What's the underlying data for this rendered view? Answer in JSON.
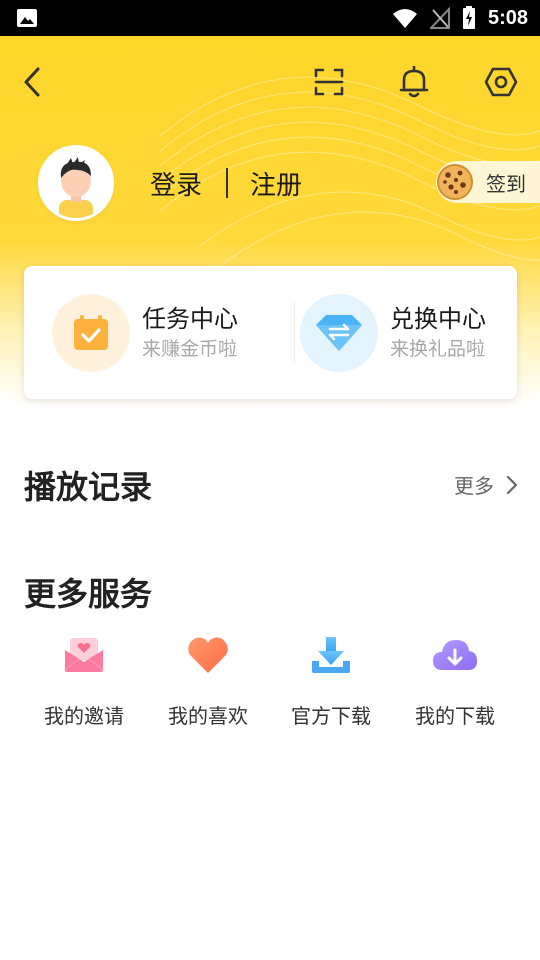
{
  "status_bar": {
    "time": "5:08"
  },
  "header": {
    "back_icon": "chevron-left-icon",
    "scan_icon": "scan-icon",
    "bell_icon": "bell-icon",
    "settings_icon": "hexagon-gear-icon"
  },
  "profile": {
    "login_label": "登录",
    "register_label": "注册",
    "checkin_label": "签到"
  },
  "cards": {
    "task": {
      "title": "任务中心",
      "subtitle": "来赚金币啦"
    },
    "exchange": {
      "title": "兑换中心",
      "subtitle": "来换礼品啦"
    }
  },
  "history": {
    "title": "播放记录",
    "more_label": "更多"
  },
  "services": {
    "title": "更多服务",
    "items": [
      {
        "label": "我的邀请",
        "icon": "invite-envelope-icon"
      },
      {
        "label": "我的喜欢",
        "icon": "heart-icon"
      },
      {
        "label": "官方下载",
        "icon": "download-tray-icon"
      },
      {
        "label": "我的下载",
        "icon": "cloud-download-icon"
      }
    ]
  },
  "colors": {
    "brand_yellow": "#ffd629",
    "task_orange": "#ffb13d",
    "exchange_blue": "#4ab3f5"
  }
}
